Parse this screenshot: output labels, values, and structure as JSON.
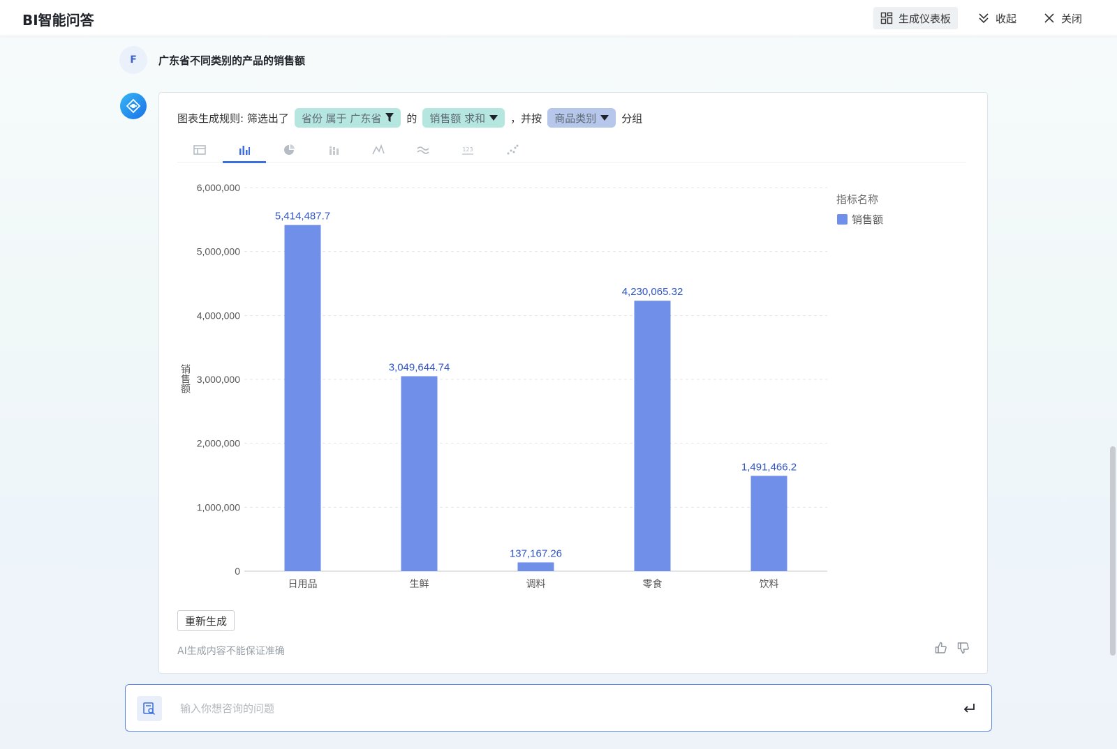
{
  "app": {
    "title": "BI智能问答"
  },
  "toolbar": {
    "dashboard_label": "生成仪表板",
    "collapse_label": "收起",
    "close_label": "关闭"
  },
  "conversation": {
    "user_initial": "F",
    "question": "广东省不同类别的产品的销售额"
  },
  "rule": {
    "prefix": "图表生成规则: 筛选出了",
    "filter_chip": "省份 属于 广东省",
    "of_text": "的",
    "measure_chip": "销售额 求和",
    "group_prefix": "，并按",
    "dimension_chip": "商品类别",
    "group_suffix": "分组"
  },
  "chart_tabs": [
    "table-icon",
    "bar-chart-icon",
    "pie-chart-icon",
    "stacked-bar-icon",
    "line-chart-icon",
    "area-chart-icon",
    "number-card-icon",
    "scatter-icon"
  ],
  "active_tab": 1,
  "chart_data": {
    "type": "bar",
    "categories": [
      "日用品",
      "生鲜",
      "调料",
      "零食",
      "饮料"
    ],
    "series": [
      {
        "name": "销售额",
        "values": [
          5414487.7,
          3049644.74,
          137167.26,
          4230065.32,
          1491466.2
        ]
      }
    ],
    "data_labels": [
      "5,414,487.7",
      "3,049,644.74",
      "137,167.26",
      "4,230,065.32",
      "1,491,466.2"
    ],
    "ylabel": "销售额",
    "ylim": [
      0,
      6000000
    ],
    "yticks": [
      "0",
      "1,000,000",
      "2,000,000",
      "3,000,000",
      "4,000,000",
      "5,000,000",
      "6,000,000"
    ],
    "legend_title": "指标名称",
    "legend_position": "top-right",
    "bar_color": "#6f8fe9",
    "label_color": "#2f54c4",
    "grid": true
  },
  "actions": {
    "regenerate_label": "重新生成"
  },
  "disclaimer": "AI生成内容不能保证准确",
  "input": {
    "placeholder": "输入你想咨询的问题"
  }
}
